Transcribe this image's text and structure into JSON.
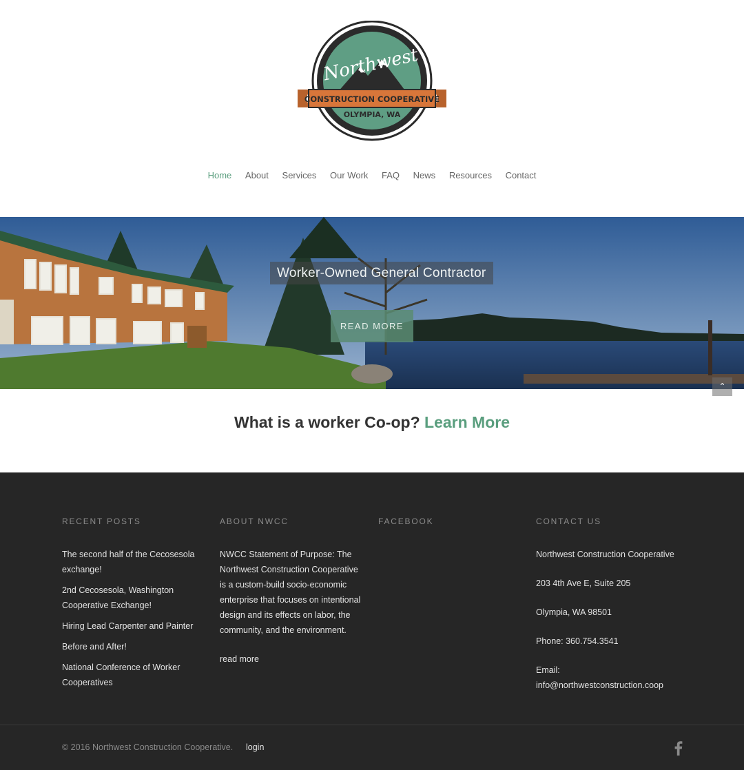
{
  "logo": {
    "text_script": "Northwest",
    "text_banner": "CONSTRUCTION COOPERATIVE",
    "text_location": "OLYMPIA, WA",
    "colors": {
      "teal": "#5f9e84",
      "orange": "#d8763a",
      "dark": "#2b2b2b"
    }
  },
  "nav": {
    "items": [
      {
        "label": "Home",
        "active": true
      },
      {
        "label": "About"
      },
      {
        "label": "Services"
      },
      {
        "label": "Our Work"
      },
      {
        "label": "FAQ"
      },
      {
        "label": "News"
      },
      {
        "label": "Resources"
      },
      {
        "label": "Contact"
      }
    ]
  },
  "hero": {
    "title": "Worker-Owned General Contractor",
    "button": "READ MORE",
    "to_top_icon": "chevron-up-icon"
  },
  "coop": {
    "question": "What is a worker Co-op?",
    "link": "Learn More"
  },
  "footer": {
    "recent_posts": {
      "title": "RECENT POSTS",
      "items": [
        "The second half of the Cecosesola exchange!",
        "2nd Cecosesola, Washington Cooperative Exchange!",
        "Hiring Lead Carpenter and Painter",
        "Before and After!",
        "National Conference of Worker Cooperatives"
      ]
    },
    "about": {
      "title": "ABOUT NWCC",
      "text": "NWCC Statement of Purpose: The Northwest Construction Cooperative is a custom-build socio-economic enterprise that focuses on intentional design and its effects on labor, the community, and the environment.",
      "more": "read more"
    },
    "facebook": {
      "title": "FACEBOOK"
    },
    "contact": {
      "title": "CONTACT US",
      "name": "Northwest Construction Cooperative",
      "address1": "203 4th Ave E, Suite 205",
      "address2": "Olympia, WA 98501",
      "phone": "Phone: 360.754.3541",
      "email_label": "Email:",
      "email": "info@northwestconstruction.coop"
    },
    "copyright": "© 2016 Northwest Construction Cooperative.",
    "login": "login",
    "social_icon": "facebook-icon"
  }
}
